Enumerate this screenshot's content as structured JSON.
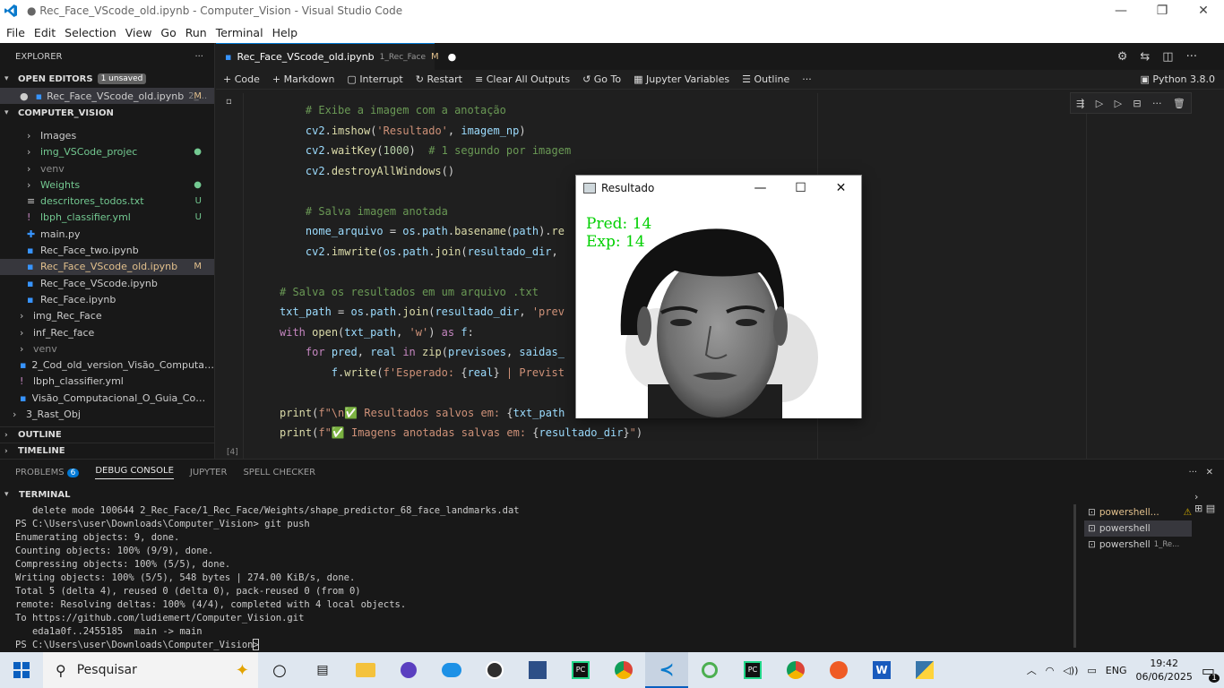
{
  "window": {
    "title": "● Rec_Face_VScode_old.ipynb - Computer_Vision - Visual Studio Code",
    "min": "—",
    "max": "❐",
    "close": "✕"
  },
  "menu": [
    "File",
    "Edit",
    "Selection",
    "View",
    "Go",
    "Run",
    "Terminal",
    "Help"
  ],
  "explorer": {
    "title": "EXPLORER",
    "more": "···",
    "open_editors": {
      "label": "OPEN EDITORS",
      "badge": "1 unsaved",
      "file": "Rec_Face_VScode_old.ipynb",
      "path": "2_...",
      "status": "M"
    },
    "project": "COMPUTER_VISION",
    "items": [
      {
        "name": "Images",
        "type": "folder",
        "indent": 30,
        "status": "",
        "color": ""
      },
      {
        "name": "img_VSCode_projec",
        "type": "folder",
        "indent": 30,
        "status": "●",
        "color": "green"
      },
      {
        "name": "venv",
        "type": "folder",
        "indent": 30,
        "status": "",
        "color": "dim"
      },
      {
        "name": "Weights",
        "type": "folder",
        "indent": 30,
        "status": "●",
        "color": "green"
      },
      {
        "name": "descritores_todos.txt",
        "type": "txt",
        "indent": 30,
        "status": "U",
        "color": "green"
      },
      {
        "name": "lbph_classifier.yml",
        "type": "yml",
        "indent": 30,
        "status": "U",
        "color": "green"
      },
      {
        "name": "main.py",
        "type": "py",
        "indent": 30,
        "status": "",
        "color": ""
      },
      {
        "name": "Rec_Face_two.ipynb",
        "type": "nb",
        "indent": 30,
        "status": "",
        "color": ""
      },
      {
        "name": "Rec_Face_VScode_old.ipynb",
        "type": "nb",
        "indent": 30,
        "status": "M",
        "color": "yellow",
        "selected": true
      },
      {
        "name": "Rec_Face_VScode.ipynb",
        "type": "nb",
        "indent": 30,
        "status": "",
        "color": ""
      },
      {
        "name": "Rec_Face.ipynb",
        "type": "nb",
        "indent": 30,
        "status": "",
        "color": ""
      },
      {
        "name": "img_Rec_Face",
        "type": "folder",
        "indent": 22,
        "status": "",
        "color": ""
      },
      {
        "name": "inf_Rec_face",
        "type": "folder",
        "indent": 22,
        "status": "",
        "color": ""
      },
      {
        "name": "venv",
        "type": "folder-open",
        "indent": 22,
        "status": "",
        "color": "dim"
      },
      {
        "name": "2_Cod_old_version_Visão_Computacional...",
        "type": "nb",
        "indent": 22,
        "status": "",
        "color": ""
      },
      {
        "name": "lbph_classifier.yml",
        "type": "yml",
        "indent": 22,
        "status": "",
        "color": ""
      },
      {
        "name": "Visão_Computacional_O_Guia_Completo...",
        "type": "nb",
        "indent": 22,
        "status": "",
        "color": ""
      },
      {
        "name": "3_Rast_Obj",
        "type": "folder",
        "indent": 14,
        "status": "",
        "color": ""
      }
    ],
    "outline": "OUTLINE",
    "timeline": "TIMELINE"
  },
  "tab": {
    "name": "Rec_Face_VScode_old.ipynb",
    "sub": "1_Rec_Face",
    "status": "M"
  },
  "toolbar": {
    "code": "Code",
    "markdown": "Markdown",
    "interrupt": "Interrupt",
    "restart": "Restart",
    "clear": "Clear All Outputs",
    "goto": "Go To",
    "vars": "Jupyter Variables",
    "outline": "Outline",
    "more": "···",
    "kernel": "Python 3.8.0"
  },
  "exec_count": "[4]",
  "panel": {
    "problems": "PROBLEMS",
    "problems_count": "6",
    "debug": "DEBUG CONSOLE",
    "jupyter": "JUPYTER",
    "spell": "SPELL CHECKER",
    "terminal": "TERMINAL",
    "terminals": [
      {
        "name": "powershell...",
        "sub": ""
      },
      {
        "name": "powershell",
        "sub": ""
      },
      {
        "name": "powershell",
        "sub": "1_Re..."
      }
    ]
  },
  "terminal_lines": [
    "   delete mode 100644 2_Rec_Face/1_Rec_Face/Weights/shape_predictor_68_face_landmarks.dat",
    "PS C:\\Users\\user\\Downloads\\Computer_Vision> git push",
    "Enumerating objects: 9, done.",
    "Counting objects: 100% (9/9), done.",
    "Compressing objects: 100% (5/5), done.",
    "Writing objects: 100% (5/5), 548 bytes | 274.00 KiB/s, done.",
    "Total 5 (delta 4), reused 0 (delta 0), pack-reused 0 (from 0)",
    "remote: Resolving deltas: 100% (4/4), completed with 4 local objects.",
    "To https://github.com/ludiemert/Computer_Vision.git",
    "   eda1a0f..2455185  main -> main",
    "PS C:\\Users\\user\\Downloads\\Computer_Vision> "
  ],
  "popup": {
    "title": "Resultado",
    "pred": "Pred: 14",
    "exp": "Exp: 14",
    "min": "—",
    "max": "☐",
    "close": "✕"
  },
  "taskbar": {
    "search": "Pesquisar",
    "lang": "ENG",
    "time": "19:42",
    "date": "06/06/2025",
    "notif": "1"
  }
}
